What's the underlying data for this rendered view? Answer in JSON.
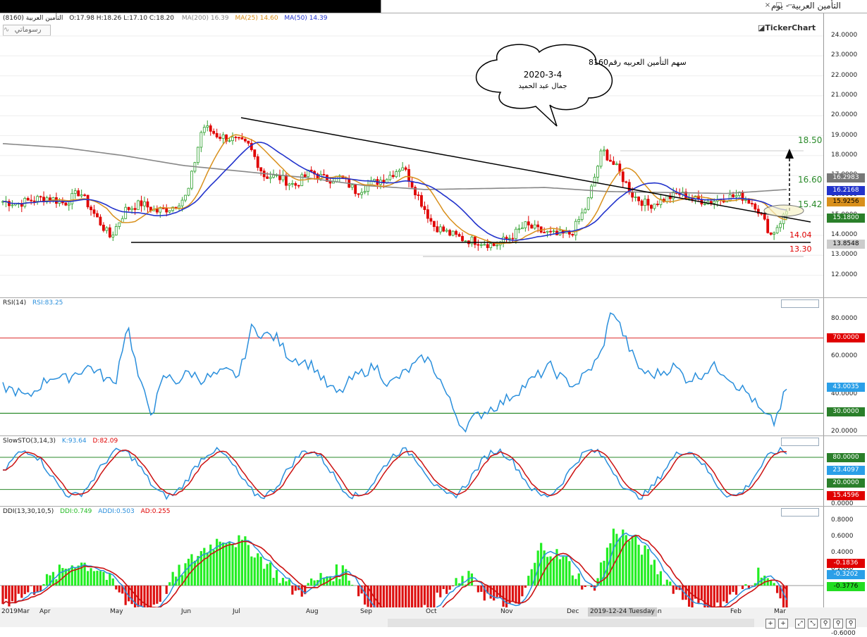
{
  "window": {
    "title": "التأمين العربية - يوم",
    "buttons": [
      "−",
      "□",
      "×"
    ]
  },
  "header": {
    "symbol": "التأمين العربية (8160)",
    "ohlc": "O:17.98  H:18.26  L:17.10  C:18.20",
    "ma200_label": "MA(200)",
    "ma200_value": "16.39",
    "ma25_label": "MA(25)",
    "ma25_value": "14.60",
    "ma50_label": "MA(50)",
    "ma50_value": "14.39",
    "draw_button": "رسوماتي",
    "brand": "TickerChart"
  },
  "annotation": {
    "line1": "سهم التأمين العربيه رقم8160",
    "line2": "2020-3-4",
    "line3": "جمال عبد الحميد"
  },
  "colors": {
    "up": "#2ea02e",
    "down": "#e00000",
    "ma25": "#d9901c",
    "ma50": "#2233cc",
    "ma200": "#888888",
    "rsi": "#2a8fdc",
    "red_line": "#e04040",
    "green_line": "#2a8a2a"
  },
  "price_axis": {
    "ticks": [
      "24.0000",
      "23.0000",
      "22.0000",
      "21.0000",
      "20.0000",
      "19.0000",
      "18.0000",
      "17.0000",
      "16.0000",
      "15.0000",
      "14.0000",
      "13.0000",
      "12.0000"
    ],
    "tags": [
      {
        "text": "16.2983",
        "bg": "#777777",
        "fg": "#ffffff"
      },
      {
        "text": "16.2168",
        "bg": "#2233cc",
        "fg": "#ffffff"
      },
      {
        "text": "15.9256",
        "bg": "#d9901c",
        "fg": "#000000"
      },
      {
        "text": "15.1800",
        "bg": "#2a7f2a",
        "fg": "#ffffff"
      },
      {
        "text": "13.8548",
        "bg": "#cccccc",
        "fg": "#000000"
      }
    ],
    "levels": [
      {
        "text": "18.50",
        "color": "#2a8a2a"
      },
      {
        "text": "16.60",
        "color": "#2a8a2a"
      },
      {
        "text": "15.42",
        "color": "#2a8a2a"
      },
      {
        "text": "14.04",
        "color": "#e00000"
      },
      {
        "text": "13.30",
        "color": "#e00000"
      }
    ]
  },
  "rsi": {
    "label": "RSI(14)",
    "value_label": "RSI:83.25",
    "ticks": [
      "80.0000",
      "60.0000",
      "40.0000",
      "20.0000"
    ],
    "tags": [
      {
        "text": "70.0000",
        "bg": "#e00000",
        "fg": "#ffffff"
      },
      {
        "text": "43.0035",
        "bg": "#2a9fe8",
        "fg": "#ffffff"
      },
      {
        "text": "30.0000",
        "bg": "#2a7f2a",
        "fg": "#ffffff"
      }
    ]
  },
  "sto": {
    "label": "SlowSTO(3,14,3)",
    "k_label": "K:93.64",
    "d_label": "D:82.09",
    "tags": [
      {
        "text": "80.0000",
        "bg": "#2a7f2a",
        "fg": "#ffffff"
      },
      {
        "text": "23.4097",
        "bg": "#2a9fe8",
        "fg": "#ffffff"
      },
      {
        "text": "20.0000",
        "bg": "#2a7f2a",
        "fg": "#ffffff"
      },
      {
        "text": "15.4596",
        "bg": "#e00000",
        "fg": "#ffffff"
      }
    ],
    "bottom_tick": "0.0000"
  },
  "ddi": {
    "label": "DDI(13,30,10,5)",
    "ddi_label": "DDI:0.749",
    "addi_label": "ADDI:0.503",
    "ad_label": "AD:0.255",
    "ticks": [
      "0.8000",
      "0.6000",
      "0.4000",
      "0.2000",
      "-0.6000"
    ],
    "tags": [
      {
        "text": "-0.1836",
        "bg": "#e00000",
        "fg": "#ffffff"
      },
      {
        "text": "-0.3202",
        "bg": "#2a9fe8",
        "fg": "#ffffff"
      },
      {
        "text": "-0.3776",
        "bg": "#22dd22",
        "fg": "#000000"
      }
    ]
  },
  "x_axis": {
    "labels": [
      "2019Mar",
      "Apr",
      "May",
      "Jun",
      "Jul",
      "Aug",
      "Sep",
      "Oct",
      "Nov",
      "Dec",
      "Jan",
      "Feb",
      "Mar"
    ],
    "cursor_label": "2019-12-24 Tuesday"
  },
  "chart_data": {
    "type": "candlestick",
    "title": "التأمين العربية (8160)",
    "x": [
      "2019-03",
      "2019-04",
      "2019-05",
      "2019-06",
      "2019-07",
      "2019-08",
      "2019-09",
      "2019-10",
      "2019-11",
      "2019-12",
      "2020-01",
      "2020-02",
      "2020-03"
    ],
    "close_approx": [
      15.7,
      15.8,
      15.2,
      15.5,
      19.0,
      17.5,
      16.8,
      14.2,
      13.8,
      14.0,
      16.2,
      15.8,
      15.18
    ],
    "ma": {
      "MA(25)": 14.6,
      "MA(50)": 14.39,
      "MA(200)": 16.39
    },
    "levels": [
      18.5,
      16.6,
      15.42,
      14.04,
      13.3
    ],
    "ylim": [
      11.5,
      24.5
    ]
  }
}
